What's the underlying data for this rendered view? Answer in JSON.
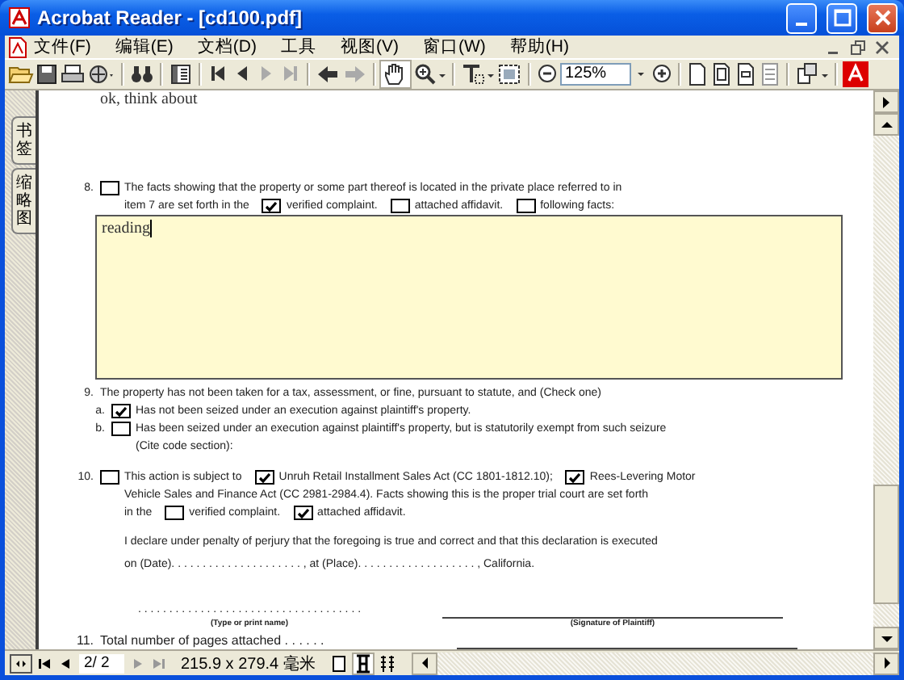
{
  "window": {
    "title": "Acrobat Reader - [cd100.pdf]"
  },
  "menu": [
    "文件(F)",
    "编辑(E)",
    "文档(D)",
    "工具",
    "视图(V)",
    "窗口(W)",
    "帮助(H)"
  ],
  "toolbar": {
    "zoom": "125%"
  },
  "nav_tabs": [
    "书签",
    "缩略图"
  ],
  "document": {
    "cut_line": "ok, think about",
    "items": [
      {
        "number": "8.",
        "checked": false,
        "lines": [
          [
            {
              "kind": "text",
              "text": "The facts showing that the property or some part thereof is located in the private place referred to in"
            }
          ],
          [
            {
              "kind": "text",
              "text": "item 7 are set forth in the"
            },
            {
              "kind": "checkbox",
              "checked": true
            },
            {
              "kind": "text",
              "text": "verified complaint."
            },
            {
              "kind": "checkbox",
              "checked": false
            },
            {
              "kind": "text",
              "text": "attached affidavit."
            },
            {
              "kind": "checkbox",
              "checked": false
            },
            {
              "kind": "text",
              "text": "following facts:"
            }
          ]
        ],
        "field": {
          "value": "reading"
        }
      },
      {
        "number": "9.",
        "lines": [
          [
            {
              "kind": "text",
              "text": "The property has not been taken for a tax, assessment, or fine, pursuant to statute, and (Check one)"
            }
          ]
        ],
        "children": [
          {
            "number": "a.",
            "checked": true,
            "lines": [
              [
                {
                  "kind": "text",
                  "text": "Has not been seized under an execution against plaintiff's property."
                }
              ]
            ]
          },
          {
            "number": "b.",
            "checked": false,
            "lines": [
              [
                {
                  "kind": "text",
                  "text": "Has been seized under an execution against plaintiff's property, but is statutorily exempt from such seizure"
                }
              ],
              [
                {
                  "kind": "text",
                  "text": "(Cite code section):"
                }
              ]
            ]
          }
        ]
      },
      {
        "number": "10.",
        "checked": false,
        "lines": [
          [
            {
              "kind": "text",
              "text": "This action is subject to"
            },
            {
              "kind": "checkbox",
              "checked": true
            },
            {
              "kind": "text",
              "text": "Unruh Retail Installment Sales Act (CC 1801-1812.10);"
            },
            {
              "kind": "checkbox",
              "checked": true
            },
            {
              "kind": "text",
              "text": "Rees-Levering Motor"
            }
          ],
          [
            {
              "kind": "text",
              "text": "Vehicle Sales and Finance Act (CC 2981-2984.4). Facts showing this is the proper trial court are set forth"
            }
          ],
          [
            {
              "kind": "text",
              "text": "in the"
            },
            {
              "kind": "checkbox",
              "checked": false
            },
            {
              "kind": "text",
              "text": "verified complaint."
            },
            {
              "kind": "checkbox",
              "checked": true
            },
            {
              "kind": "text",
              "text": "attached affidavit."
            }
          ]
        ]
      }
    ],
    "declaration": [
      "I declare under penalty of perjury that the foregoing is true and correct and that this declaration is executed",
      "on (Date). . . . . . . . . . . . . . . . . . . . . , at (Place). . . . . . . . . . . . . . . . . . . , California."
    ],
    "signature": {
      "name_dots": ". . . . . . . . . . . . . . . . . . . . . . . . . . . . . . . . . . . .",
      "name_caption": "(Type or print name)",
      "signature_caption": "(Signature of Plaintiff)"
    },
    "total": {
      "number": "11.",
      "text": "Total number of pages attached . . . . . ."
    }
  },
  "status_bar": {
    "page": "2/ 2",
    "size": "215.9 x 279.4 毫米"
  }
}
